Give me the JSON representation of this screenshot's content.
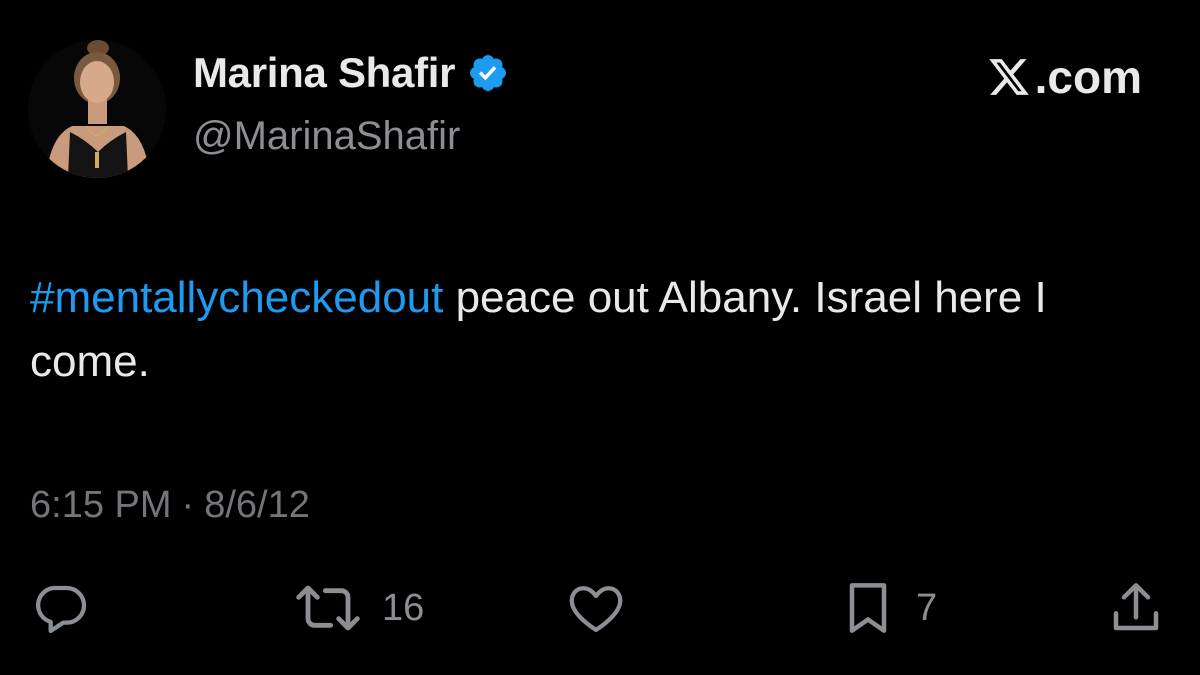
{
  "author": {
    "display_name": "Marina Shafir",
    "handle": "@MarinaShafir",
    "verified": true,
    "verified_color": "#1d9bf0"
  },
  "brand": {
    "icon": "x-logo-icon",
    "suffix": ".com"
  },
  "tweet": {
    "hashtag": "#mentallycheckedout",
    "text": " peace out Albany. Israel here I come.",
    "hashtag_color": "#1d9bf0"
  },
  "meta": {
    "time": "6:15 PM",
    "separator": "·",
    "date": "8/6/12"
  },
  "actions": {
    "reply": {
      "icon": "reply-icon",
      "count": ""
    },
    "retweet": {
      "icon": "retweet-icon",
      "count": "16"
    },
    "like": {
      "icon": "heart-icon",
      "count": ""
    },
    "bookmark": {
      "icon": "bookmark-icon",
      "count": "7"
    },
    "share": {
      "icon": "share-icon",
      "count": ""
    }
  },
  "colors": {
    "background": "#000000",
    "text": "#e7e9ea",
    "muted": "#71767b"
  }
}
